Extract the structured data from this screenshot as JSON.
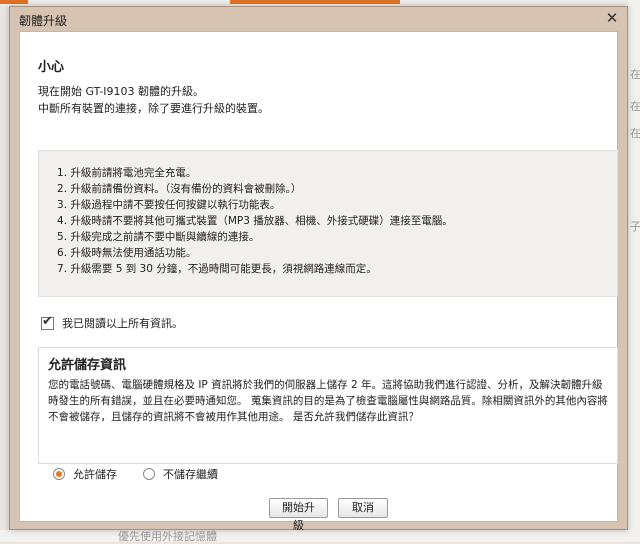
{
  "dialog": {
    "title": "韌體升級",
    "close_glyph": "✕"
  },
  "caution": {
    "heading": "小心",
    "line1": "現在開始 GT-I9103 韌體的升級。",
    "line2": "中斷所有裝置的連接，除了要進行升級的裝置。"
  },
  "notice_items": [
    "1. 升級前請將電池完全充電。",
    "2. 升級前請備份資料。（沒有備份的資料會被刪除。）",
    "3. 升級過程中請不要按任何按鍵以執行功能表。",
    "4. 升級時請不要將其他可攜式裝置（MP3 播放器、相機、外接式硬碟）連接至電腦。",
    "5. 升級完成之前請不要中斷與續線的連接。",
    "6. 升級時無法使用通話功能。",
    "7. 升級需要 5 到 30 分鐘，不過時間可能更長，須視網路連線而定。"
  ],
  "agree": {
    "label": "我已閱讀以上所有資訊。",
    "checked": true
  },
  "consent": {
    "title": "允許儲存資訊",
    "body": "您的電話號碼、電腦硬體規格及 IP 資訊將於我們的伺服器上儲存 2 年。這將協助我們進行認證、分析，及解決韌體升級時發生的所有錯誤，並且在必要時通知您。 蒐集資訊的目的是為了檢查電腦屬性與網路品質。除相關資訊外的其他內容將不會被儲存，且儲存的資訊將不會被用作其他用途。 是否允許我們儲存此資訊？"
  },
  "radios": {
    "allow_label": "允許儲存",
    "deny_label": "不儲存繼續",
    "selected": "allow"
  },
  "buttons": {
    "start": "開始升級",
    "cancel": "取消"
  },
  "background": {
    "right_text": [
      "在",
      "在",
      "在",
      "子"
    ],
    "bottom_text": "優先使用外接記憶體"
  },
  "colors": {
    "accent": "#e27425",
    "dialog_frame": "#d7c3b2"
  }
}
